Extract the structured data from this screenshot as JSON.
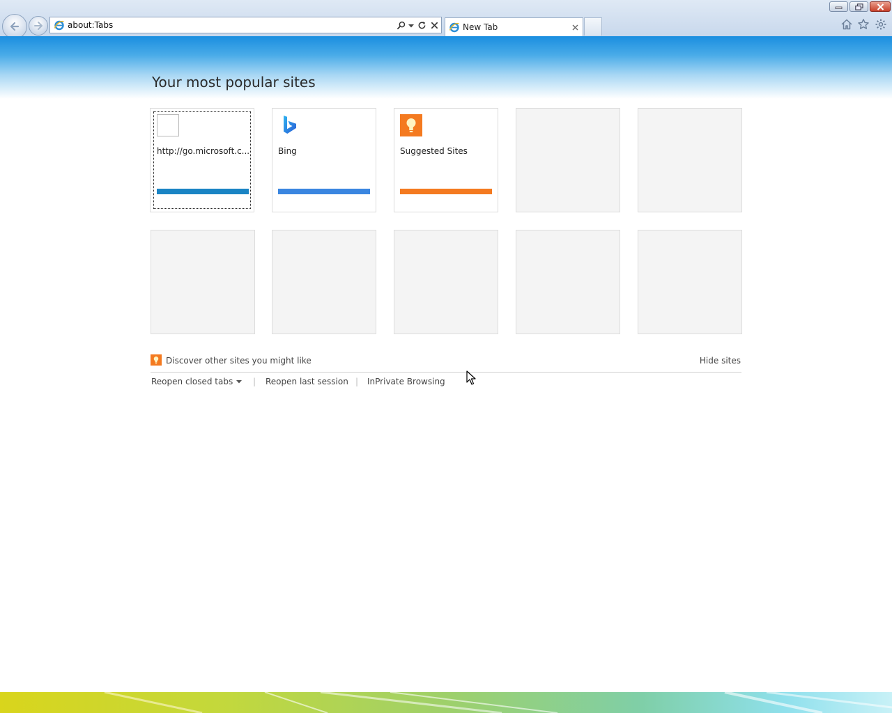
{
  "window": {
    "controls": {
      "minimize": "minimize",
      "maximize": "restore",
      "close": "close"
    }
  },
  "address_bar": {
    "url": "about:Tabs",
    "icons": [
      "ie-icon",
      "search-icon",
      "dropdown-icon",
      "refresh-icon",
      "stop-icon"
    ]
  },
  "tab": {
    "title": "New Tab"
  },
  "toolbar_icons": [
    "home-icon",
    "favorites-star-icon",
    "gear-icon"
  ],
  "page": {
    "title": "Your most popular sites",
    "tiles_row1": [
      {
        "label": "http://go.microsoft.c...",
        "bar_color": "#1a84c4",
        "icon": "blank-page-icon"
      },
      {
        "label": "Bing",
        "bar_color": "#3a86e0",
        "icon": "bing-icon"
      },
      {
        "label": "Suggested Sites",
        "bar_color": "#f47a20",
        "icon": "suggested-sites-icon"
      },
      {
        "label": ""
      },
      {
        "label": ""
      }
    ],
    "discover_text": "Discover other sites you might like",
    "hide_sites": "Hide sites",
    "links": {
      "reopen_closed_tabs": "Reopen closed tabs",
      "separator": "|",
      "reopen_last_session": "Reopen last session",
      "inprivate": "InPrivate Browsing"
    }
  },
  "colors": {
    "banner_blue": "#1a8ee0",
    "accent_orange": "#f47a20"
  }
}
